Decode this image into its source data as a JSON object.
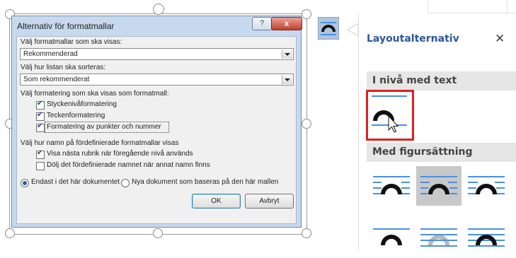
{
  "dialog": {
    "title": "Alternativ för formatmallar",
    "help_glyph": "?",
    "close_glyph": "x",
    "show_label": "Välj formatmallar som ska visas:",
    "show_value": "Rekommenderad",
    "sort_label": "Välj hur listan ska sorteras:",
    "sort_value": "Som rekommenderat",
    "format_label": "Välj formatering som ska visas som formatmall:",
    "format_options": [
      {
        "label": "Styckenivåformatering",
        "checked": true
      },
      {
        "label": "Teckenformatering",
        "checked": true
      },
      {
        "label": "Formatering av punkter och nummer",
        "checked": true
      }
    ],
    "names_label": "Välj hur namn på fördefinierade formatmallar visas",
    "name_options": [
      {
        "label": "Visa nästa rubrik när föregående nivå används",
        "checked": true
      },
      {
        "label": "Dölj det fördefinierade namnet när annat namn finns",
        "checked": false
      }
    ],
    "scope_options": [
      {
        "label": "Endast i det här dokumentet",
        "selected": true
      },
      {
        "label": "Nya dokument som baseras på den här mallen",
        "selected": false
      }
    ],
    "ok_label": "OK",
    "cancel_label": "Avbryt"
  },
  "pane": {
    "title": "Layoutalternativ",
    "close_glyph": "✕",
    "section_inline": "I nivå med text",
    "section_wrap": "Med figursättning"
  },
  "colors": {
    "accent": "#2b579a",
    "highlight": "#e02020",
    "line_blue": "#4a90e2",
    "selected_bg": "#c8c8c8"
  }
}
